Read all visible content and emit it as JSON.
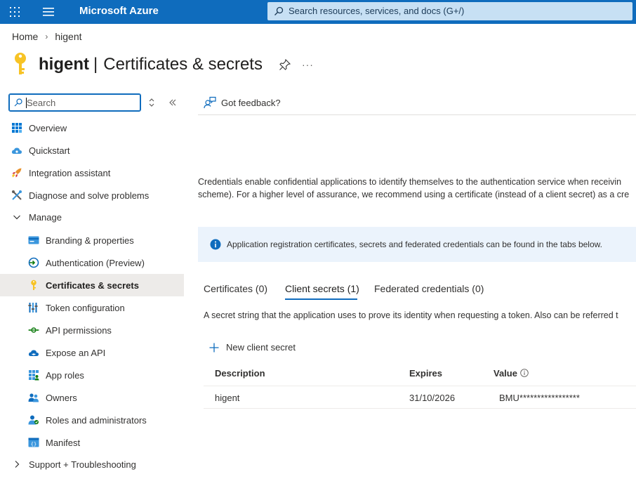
{
  "topbar": {
    "brand": "Microsoft Azure",
    "search_placeholder": "Search resources, services, and docs (G+/)",
    "color": "#0f6cbd"
  },
  "breadcrumb": {
    "home": "Home",
    "current": "higent"
  },
  "title": {
    "app": "higent",
    "separator": "|",
    "page": "Certificates & secrets"
  },
  "sidebar": {
    "search_placeholder": "Search",
    "items": [
      {
        "label": "Overview",
        "icon": "overview-grid-icon",
        "level": 1
      },
      {
        "label": "Quickstart",
        "icon": "cloud-icon",
        "level": 1
      },
      {
        "label": "Integration assistant",
        "icon": "rocket-icon",
        "level": 1
      },
      {
        "label": "Diagnose and solve problems",
        "icon": "wrench-icon",
        "level": 1
      }
    ],
    "manage_label": "Manage",
    "manage_items": [
      {
        "label": "Branding & properties",
        "icon": "branding-icon"
      },
      {
        "label": "Authentication (Preview)",
        "icon": "authentication-icon"
      },
      {
        "label": "Certificates & secrets",
        "icon": "key-icon",
        "active": true
      },
      {
        "label": "Token configuration",
        "icon": "token-bars-icon"
      },
      {
        "label": "API permissions",
        "icon": "api-permissions-icon"
      },
      {
        "label": "Expose an API",
        "icon": "cloud-api-icon"
      },
      {
        "label": "App roles",
        "icon": "app-roles-grid-icon"
      },
      {
        "label": "Owners",
        "icon": "owners-icon"
      },
      {
        "label": "Roles and administrators",
        "icon": "roles-admin-icon"
      },
      {
        "label": "Manifest",
        "icon": "manifest-icon"
      }
    ],
    "support_label": "Support + Troubleshooting"
  },
  "content": {
    "feedback": "Got feedback?",
    "description_line1": "Credentials enable confidential applications to identify themselves to the authentication service when receivin",
    "description_line2": "scheme). For a higher level of assurance, we recommend using a certificate (instead of a client secret) as a cre",
    "info": "Application registration certificates, secrets and federated credentials can be found in the tabs below.",
    "tabs": [
      "Certificates (0)",
      "Client secrets (1)",
      "Federated credentials (0)"
    ],
    "tab_description": "A secret string that the application uses to prove its identity when requesting a token. Also can be referred t",
    "new_secret": "New client secret",
    "table": {
      "headers": [
        "Description",
        "Expires",
        "Value"
      ],
      "rows": [
        {
          "description": "higent",
          "expires": "31/10/2026",
          "value": "BMU*****************"
        }
      ]
    }
  }
}
